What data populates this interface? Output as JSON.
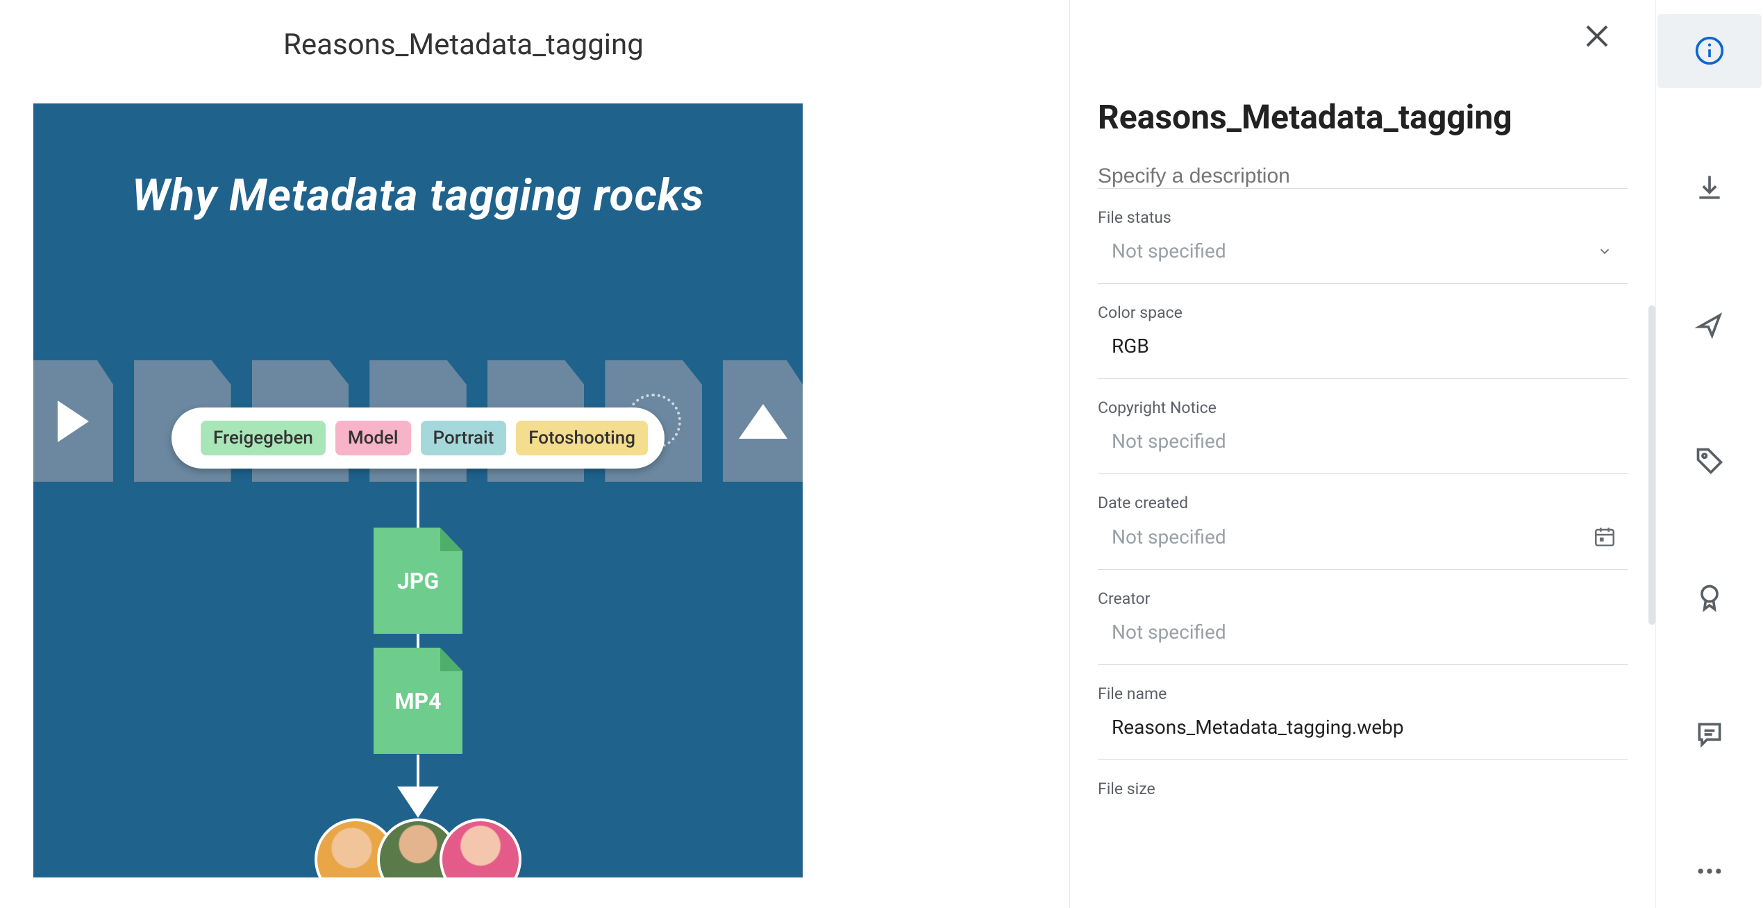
{
  "left": {
    "title": "Reasons_Metadata_tagging",
    "preview": {
      "heading": "Why Metadata tagging rocks",
      "tags": [
        "Freigegeben",
        "Model",
        "Portrait",
        "Fotoshooting"
      ],
      "file_labels": {
        "jpg": "JPG",
        "mp4": "MP4"
      }
    }
  },
  "details": {
    "title": "Reasons_Metadata_tagging",
    "description_placeholder": "Specify a description",
    "fields": {
      "file_status": {
        "label": "File status",
        "value": "Not specified",
        "is_placeholder": true
      },
      "color_space": {
        "label": "Color space",
        "value": "RGB",
        "is_placeholder": false
      },
      "copyright": {
        "label": "Copyright Notice",
        "value": "Not specified",
        "is_placeholder": true
      },
      "date_created": {
        "label": "Date created",
        "value": "Not specified",
        "is_placeholder": true
      },
      "creator": {
        "label": "Creator",
        "value": "Not specified",
        "is_placeholder": true
      },
      "file_name": {
        "label": "File name",
        "value": "Reasons_Metadata_tagging.webp",
        "is_placeholder": false
      },
      "file_size": {
        "label": "File size",
        "value": "",
        "is_placeholder": false
      }
    }
  },
  "iconbar": {
    "items": [
      "info",
      "download",
      "share",
      "tag",
      "award",
      "comment",
      "more"
    ]
  }
}
